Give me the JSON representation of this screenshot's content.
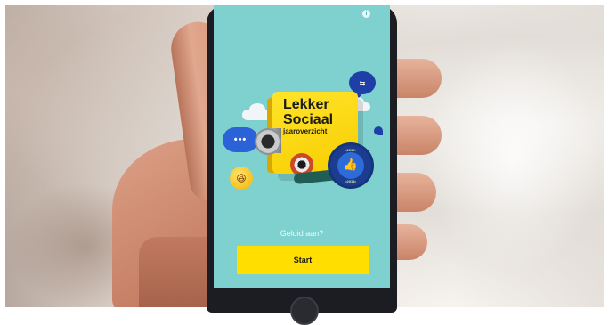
{
  "app": {
    "title_line1": "Lekker",
    "title_line2": "Sociaal",
    "subtitle": "jaaroverzicht",
    "badge_top": "•2017•",
    "badge_bottom": "•2018•",
    "sound_prompt": "Geluid aan?",
    "start_label": "Start"
  },
  "icons": {
    "info": "info-icon",
    "chat": "chat-bubble-icon",
    "dots": "typing-dots-icon",
    "emoji": "laughing-emoji-icon",
    "like": "thumbs-up-icon",
    "megaphone": "megaphone-icon",
    "camera": "camera-lens-icon"
  },
  "colors": {
    "screen_bg": "#7fd1cf",
    "accent_yellow": "#ffde00",
    "accent_blue": "#2c62d8"
  }
}
